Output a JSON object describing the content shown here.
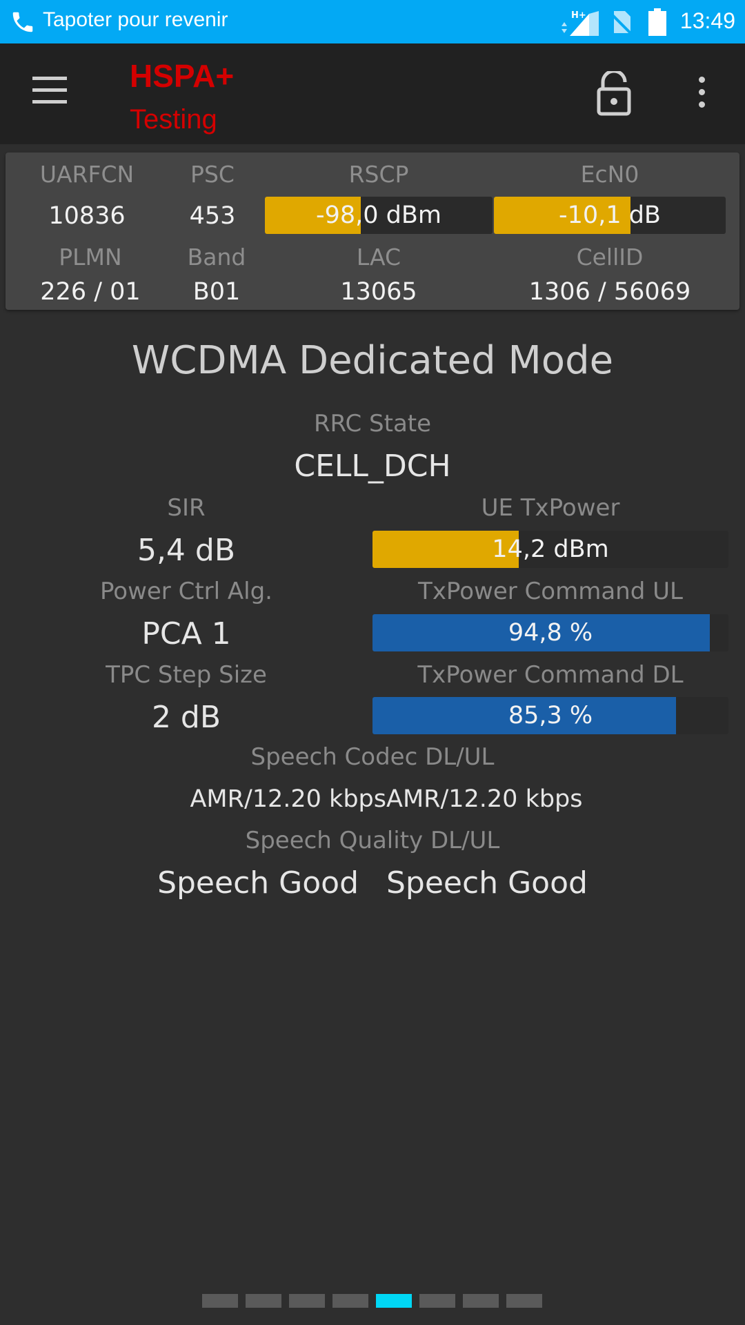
{
  "status_bar": {
    "text": "Tapoter pour revenir",
    "network": "H+",
    "time": "13:49",
    "color": "#03a9f4"
  },
  "toolbar": {
    "title": "HSPA+",
    "subtitle": "Testing",
    "title_color": "#d40000",
    "icons": [
      "menu-icon",
      "lock-open-icon",
      "more-vert-icon"
    ]
  },
  "cell_info": {
    "uarfcn_label": "UARFCN",
    "uarfcn": "10836",
    "psc_label": "PSC",
    "psc": "453",
    "rscp_label": "RSCP",
    "rscp": "-98,0 dBm",
    "rscp_level": 0.42,
    "ecn0_label": "EcN0",
    "ecn0": "-10,1 dB",
    "ecn0_level": 0.59,
    "plmn_label": "PLMN",
    "plmn": "226 / 01",
    "band_label": "Band",
    "band": "B01",
    "lac_label": "LAC",
    "lac": "13065",
    "cellid_label": "CellID",
    "cellid": "1306 / 56069",
    "bar_color": "#e0a800"
  },
  "wcdma": {
    "title": "WCDMA Dedicated Mode",
    "rrc_label": "RRC State",
    "rrc": "CELL_DCH",
    "sir_label": "SIR",
    "sir": "5,4 dB",
    "ue_tx_label": "UE TxPower",
    "ue_tx": "14,2 dBm",
    "ue_tx_level": 0.41,
    "pca_label": "Power Ctrl Alg.",
    "pca": "PCA 1",
    "cmd_ul_label": "TxPower Command UL",
    "cmd_ul": "94,8 %",
    "cmd_ul_level": 0.948,
    "tpc_label": "TPC Step Size",
    "tpc": "2 dB",
    "cmd_dl_label": "TxPower Command DL",
    "cmd_dl": "85,3 %",
    "cmd_dl_level": 0.853,
    "codec_label": "Speech Codec DL/UL",
    "codec_dl": "AMR/12.20 kbps",
    "codec_ul": "AMR/12.20 kbps",
    "quality_label": "Speech Quality DL/UL",
    "quality_dl": "Speech Good",
    "quality_ul": "Speech Good",
    "yellow": "#e0a800",
    "blue": "#1a5fa8"
  },
  "pager": {
    "count": 8,
    "active_index": 4,
    "active_color": "#00d7f5"
  }
}
